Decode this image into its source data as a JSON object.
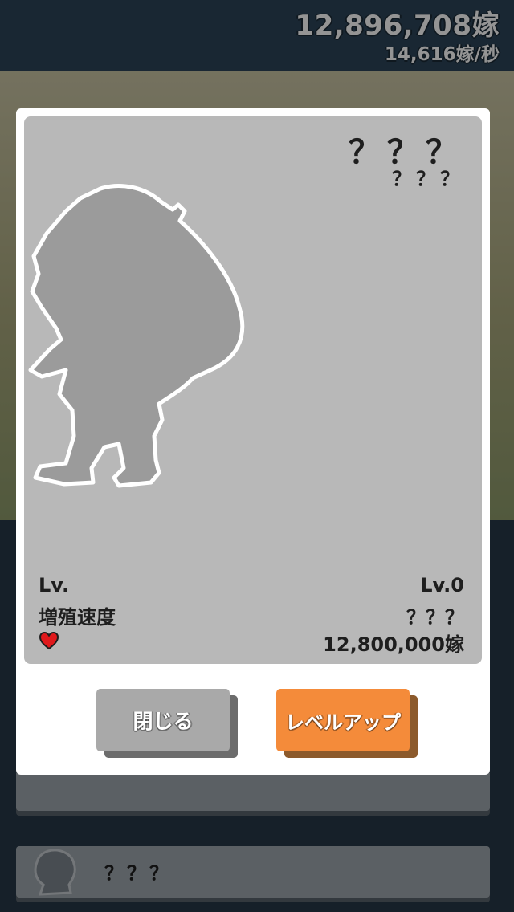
{
  "hud": {
    "total_count": "12,896,708嫁",
    "rate": "14,616嫁/秒"
  },
  "background_list": {
    "row2_label": "？？？"
  },
  "character_card": {
    "name": "？？？",
    "subtitle": "？？？",
    "level_label": "Lv.",
    "level_value": "Lv.0",
    "speed_label": "増殖速度",
    "speed_value": "？？？",
    "cost_value": "12,800,000嫁",
    "cost_icon": "heart-icon"
  },
  "buttons": {
    "close_label": "閉じる",
    "levelup_label": "レベルアップ"
  },
  "colors": {
    "card_bg": "#b8b8b8",
    "levelup_button": "#f48b3a",
    "close_button": "#a9a9a9",
    "heart": "#e0191c"
  }
}
